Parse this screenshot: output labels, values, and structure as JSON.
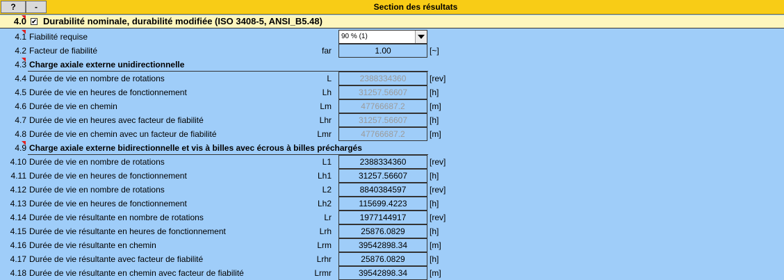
{
  "toolbar": {
    "help_label": "?",
    "collapse_label": "-",
    "title": "Section des résultats"
  },
  "section": {
    "number": "4.0",
    "checked_mark": "✔",
    "title": "Durabilité nominale, durabilité modifiée (ISO 3408-5, ANSI_B5.48)"
  },
  "rows": [
    {
      "num": "4.1",
      "label": "Fiabilité requise",
      "sym": "",
      "value": "90 % (1)",
      "unit": "",
      "kind": "select"
    },
    {
      "num": "4.2",
      "label": "Facteur de fiabilité",
      "sym": "far",
      "value": "1.00",
      "unit": "[~]",
      "kind": "value"
    },
    {
      "num": "4.3",
      "label": "Charge axiale externe unidirectionnelle",
      "sym": "",
      "value": "",
      "unit": "",
      "kind": "subheader"
    },
    {
      "num": "4.4",
      "label": "Durée de vie en nombre de rotations",
      "sym": "L",
      "value": "2388334360",
      "unit": "[rev]",
      "kind": "grey"
    },
    {
      "num": "4.5",
      "label": "Durée de vie en heures de fonctionnement",
      "sym": "Lh",
      "value": "31257.56607",
      "unit": "[h]",
      "kind": "grey"
    },
    {
      "num": "4.6",
      "label": "Durée de vie en chemin",
      "sym": "Lm",
      "value": "47766687.2",
      "unit": "[m]",
      "kind": "grey"
    },
    {
      "num": "4.7",
      "label": "Durée de vie en heures avec facteur de fiabilité",
      "sym": "Lhr",
      "value": "31257.56607",
      "unit": "[h]",
      "kind": "grey"
    },
    {
      "num": "4.8",
      "label": "Durée de vie en chemin avec un facteur de fiabilité",
      "sym": "Lmr",
      "value": "47766687.2",
      "unit": "[m]",
      "kind": "grey"
    },
    {
      "num": "4.9",
      "label": "Charge axiale externe bidirectionnelle et vis à billes avec écrous à billes préchargés",
      "sym": "",
      "value": "",
      "unit": "",
      "kind": "subheader"
    },
    {
      "num": "4.10",
      "label": "Durée de vie en nombre de rotations",
      "sym": "L1",
      "value": "2388334360",
      "unit": "[rev]",
      "kind": "value"
    },
    {
      "num": "4.11",
      "label": "Durée de vie en heures de fonctionnement",
      "sym": "Lh1",
      "value": "31257.56607",
      "unit": "[h]",
      "kind": "value"
    },
    {
      "num": "4.12",
      "label": "Durée de vie en nombre de rotations",
      "sym": "L2",
      "value": "8840384597",
      "unit": "[rev]",
      "kind": "value"
    },
    {
      "num": "4.13",
      "label": "Durée de vie en heures de fonctionnement",
      "sym": "Lh2",
      "value": "115699.4223",
      "unit": "[h]",
      "kind": "value"
    },
    {
      "num": "4.14",
      "label": "Durée de vie résultante en nombre de rotations",
      "sym": "Lr",
      "value": "1977144917",
      "unit": "[rev]",
      "kind": "value"
    },
    {
      "num": "4.15",
      "label": "Durée de vie résultante en heures de fonctionnement",
      "sym": "Lrh",
      "value": "25876.0829",
      "unit": "[h]",
      "kind": "value"
    },
    {
      "num": "4.16",
      "label": "Durée de vie résultante en chemin",
      "sym": "Lrm",
      "value": "39542898.34",
      "unit": "[m]",
      "kind": "value"
    },
    {
      "num": "4.17",
      "label": "Durée de vie résultante avec facteur de fiabilité",
      "sym": "Lrhr",
      "value": "25876.0829",
      "unit": "[h]",
      "kind": "value"
    },
    {
      "num": "4.18",
      "label": "Durée de vie résultante en chemin avec facteur de fiabilité",
      "sym": "Lrmr",
      "value": "39542898.34",
      "unit": "[m]",
      "kind": "value"
    }
  ],
  "colors": {
    "background": "#9fcdf9",
    "toolbar": "#f8cc16",
    "section_header": "#fdf6bd",
    "disabled_value": "#9b9b9b",
    "comment_marker": "#e02020"
  }
}
